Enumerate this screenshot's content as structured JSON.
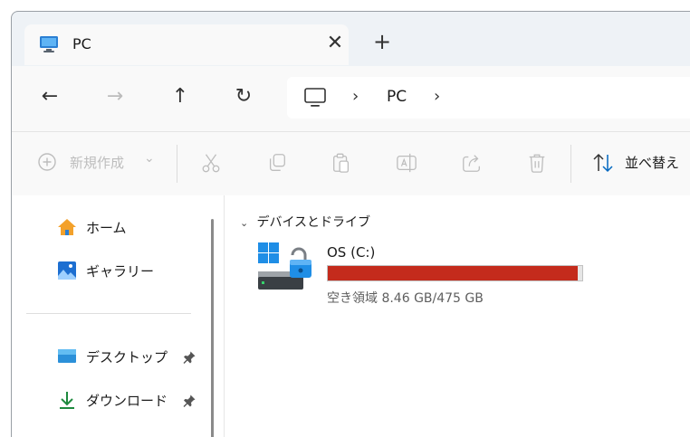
{
  "tab": {
    "title": "PC",
    "icon": "monitor-icon",
    "close_glyph": "✕",
    "new_tab_glyph": "+"
  },
  "nav": {
    "back_glyph": "←",
    "forward_glyph": "→",
    "up_glyph": "↑",
    "refresh_glyph": "↻",
    "address": {
      "chevron1": "›",
      "crumb": "PC",
      "chevron2": "›"
    }
  },
  "commands": {
    "new_label": "新規作成",
    "new_chevron": "⌄",
    "sort_label": "並べ替え"
  },
  "sidebar": {
    "items": [
      {
        "label": "ホーム",
        "icon": "home-icon"
      },
      {
        "label": "ギャラリー",
        "icon": "gallery-icon"
      },
      {
        "label": "デスクトップ",
        "icon": "desktop-icon",
        "pinned": true
      },
      {
        "label": "ダウンロード",
        "icon": "download-icon",
        "pinned": true
      }
    ]
  },
  "main": {
    "section_chevron": "⌄",
    "section_title": "デバイスとドライブ",
    "drive": {
      "name": "OS (C:)",
      "free_text": "空き領域 8.46 GB/475 GB",
      "used_fraction": 0.982,
      "bar_color": "#c42b1c"
    }
  },
  "colors": {
    "accent": "#0067c0",
    "window_bg": "#eef2f6",
    "bar_red": "#c42b1c"
  }
}
